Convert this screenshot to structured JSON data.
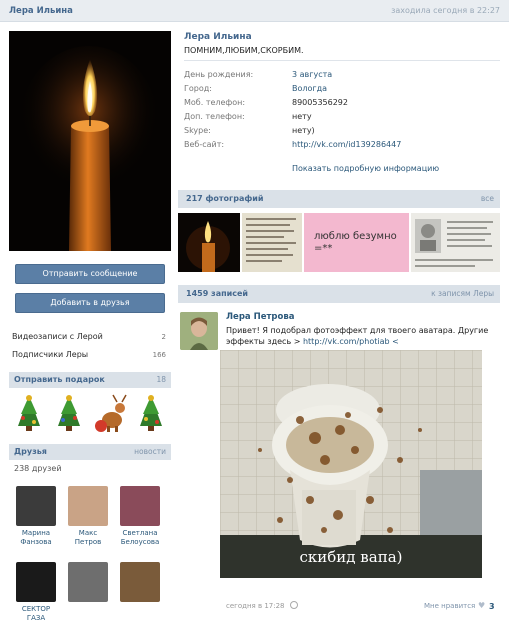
{
  "topbar": {
    "name": "Лера Ильина",
    "status": "заходила сегодня в 22:27"
  },
  "profile": {
    "name": "Лера Ильина",
    "status": "ПОМНИМ,ЛЮБИМ,СКОРБИМ.",
    "info": [
      {
        "key": "День рождения:",
        "value": "3 августа",
        "link": true
      },
      {
        "key": "Город:",
        "value": "Вологда",
        "link": true
      },
      {
        "key": "Моб. телефон:",
        "value": "89005356292",
        "link": false
      },
      {
        "key": "Доп. телефон:",
        "value": "нету",
        "link": false
      },
      {
        "key": "Skype:",
        "value": "нету)",
        "link": false
      },
      {
        "key": "Веб-сайт:",
        "value": "http://vk.com/id139286447",
        "link": true
      }
    ],
    "more": "Показать подробную информацию"
  },
  "buttons": {
    "message": "Отправить сообщение",
    "add": "Добавить в друзья"
  },
  "side": {
    "videos": {
      "label": "Видеозаписи с Лерой",
      "count": "2"
    },
    "subscribers": {
      "label": "Подписчики Леры",
      "count": "166"
    },
    "gifts": {
      "title": "Отправить подарок",
      "count": "18"
    },
    "friends": {
      "title": "Друзья",
      "action": "новости",
      "count": "238 друзей"
    }
  },
  "friends": [
    {
      "first": "Марина",
      "last": "Фанзова",
      "color": "#3b3b3b"
    },
    {
      "first": "Макс",
      "last": "Петров",
      "color": "#c9a386"
    },
    {
      "first": "Светлана",
      "last": "Белоусова",
      "color": "#8a4b5a"
    },
    {
      "first": "СЕКТОР ГАЗА",
      "last": "",
      "color": "#1a1a1a"
    },
    {
      "first": "",
      "last": "",
      "color": "#6e6e6e"
    },
    {
      "first": "",
      "last": "",
      "color": "#7a5b3a"
    }
  ],
  "photos": {
    "title": "217 фотографий",
    "action": "все",
    "text_photo": "люблю безумно =**"
  },
  "posts": {
    "title": "1459 записей",
    "action": "к записям Леры"
  },
  "post": {
    "author": "Лера Петрова",
    "text": "Привет! Я подобрал фотоэффект для твоего аватара. Другие эффекты здесь >",
    "link": "http://vk.com/photiab <",
    "caption": "скибид вапа)",
    "date": "сегодня в 17:28",
    "like_label": "Мне нравится",
    "like_count": "3"
  }
}
